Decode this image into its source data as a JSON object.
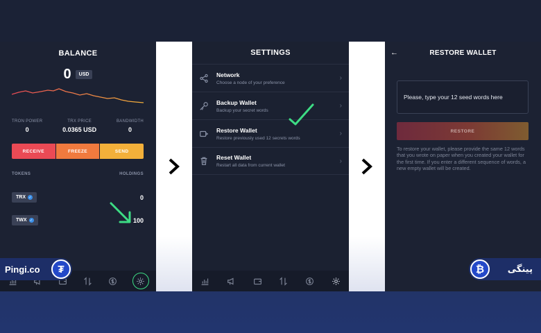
{
  "balance": {
    "title": "BALANCE",
    "amount": "0",
    "currency": "USD",
    "stats": [
      {
        "label": "TRON POWER",
        "value": "0"
      },
      {
        "label": "TRX PRICE",
        "value": "0.0365 USD"
      },
      {
        "label": "BANDWIDTH",
        "value": "0"
      }
    ],
    "actions": {
      "receive": "RECEIVE",
      "freeze": "FREEZE",
      "send": "SEND"
    },
    "tokens_header": {
      "left": "TOKENS",
      "right": "HOLDINGS"
    },
    "tokens": [
      {
        "symbol": "TRX",
        "holding": "0"
      },
      {
        "symbol": "TWX",
        "holding": "100"
      }
    ]
  },
  "settings": {
    "title": "SETTINGS",
    "items": [
      {
        "title": "Network",
        "subtitle": "Choose a node of your preference",
        "icon": "share-icon"
      },
      {
        "title": "Backup Wallet",
        "subtitle": "Backup your secret words",
        "icon": "key-icon"
      },
      {
        "title": "Restore Wallet",
        "subtitle": "Restore previously used 12 secrets words",
        "icon": "wallet-restore-icon"
      },
      {
        "title": "Reset Wallet",
        "subtitle": "Restart all data from current wallet",
        "icon": "trash-icon"
      }
    ]
  },
  "restore": {
    "title": "RESTORE WALLET",
    "placeholder": "Please, type your 12 seed words here",
    "button": "RESTORE",
    "info": "To restore your wallet, please provide the same 12 words that you wrote on paper when you created your wallet for the first time. If you enter a different sequence of words, a new empty wallet will be created."
  },
  "watermark": {
    "left": "Pingi.co",
    "left_coin": "₮",
    "right": "پینگی",
    "right_coin": "₿"
  },
  "colors": {
    "receive": "#ea4a55",
    "freeze": "#f07a3e",
    "send": "#f3b03a",
    "highlight": "#3ddc84"
  }
}
